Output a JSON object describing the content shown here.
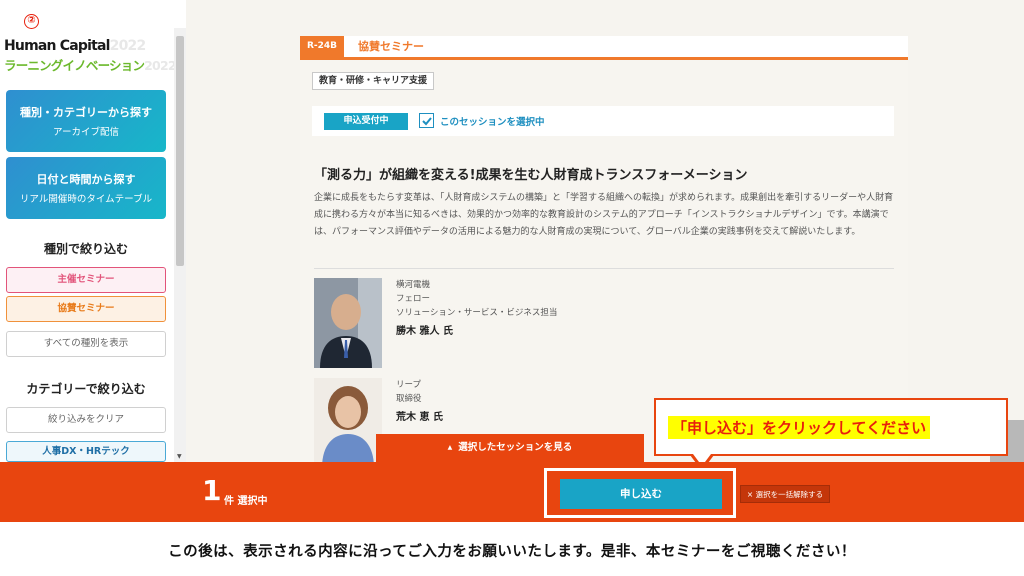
{
  "annotation": {
    "step_number": "②"
  },
  "logo": {
    "line1": "Human Capital",
    "line1_year": "2022",
    "line2": "ラーニングイノベーション",
    "line2_year": "2022"
  },
  "sidebar": {
    "nav": [
      {
        "title": "種別・カテゴリーから探す",
        "sub": "アーカイブ配信"
      },
      {
        "title": "日付と時間から探す",
        "sub": "リアル開催時のタイムテーブル"
      }
    ],
    "type_filter_heading": "種別で絞り込む",
    "type_filters": [
      "主催セミナー",
      "協賛セミナー",
      "すべての種別を表示"
    ],
    "category_filter_heading": "カテゴリーで絞り込む",
    "category_clear": "絞り込みをクリア",
    "category_items": [
      "人事DX・HRテック"
    ]
  },
  "session": {
    "code": "R-24B",
    "type": "協賛セミナー",
    "tag": "教育・研修・キャリア支援",
    "status": "申込受付中",
    "select_label": "このセッションを選択中",
    "selected": true,
    "title": "「測る力」が組織を変える!成果を生む人財育成トランスフォーメーション",
    "description": "企業に成長をもたらす変革は、「人財育成システムの構築」と「学習する組織への転換」が求められます。成果創出を牽引するリーダーや人財育成に携わる方々が本当に知るべきは、効果的かつ効率的な教育設計のシステム的アプローチ「インストラクショナルデザイン」です。本講演では、パフォーマンス評価やデータの活用による魅力的な人財育成の実現について、グローバル企業の実践事例を交えて解説いたします。",
    "speakers": [
      {
        "company": "横河電機",
        "role": "フェロー",
        "dept": "ソリューション・サービス・ビジネス担当",
        "name": "勝木 雅人 氏"
      },
      {
        "company": "リープ",
        "role": "取締役",
        "dept": "",
        "name": "荒木 恵 氏"
      }
    ]
  },
  "view_selected_label": "選択したセッションを見る",
  "callout": "「申し込む」をクリックしてください",
  "bottom_bar": {
    "count": "1",
    "count_label": "件 選択中",
    "apply_label": "申し込む",
    "clear_label": "× 選択を一括解除する"
  },
  "footer_note": "この後は、表示される内容に沿ってご入力をお願いいたします。是非、本セミナーをご視聴ください！",
  "colors": {
    "accent_orange": "#e8450f",
    "tab_orange": "#f0792b",
    "primary_blue": "#19a4c6",
    "annotation_red": "#e8200c",
    "highlight_yellow": "#ffff00"
  }
}
